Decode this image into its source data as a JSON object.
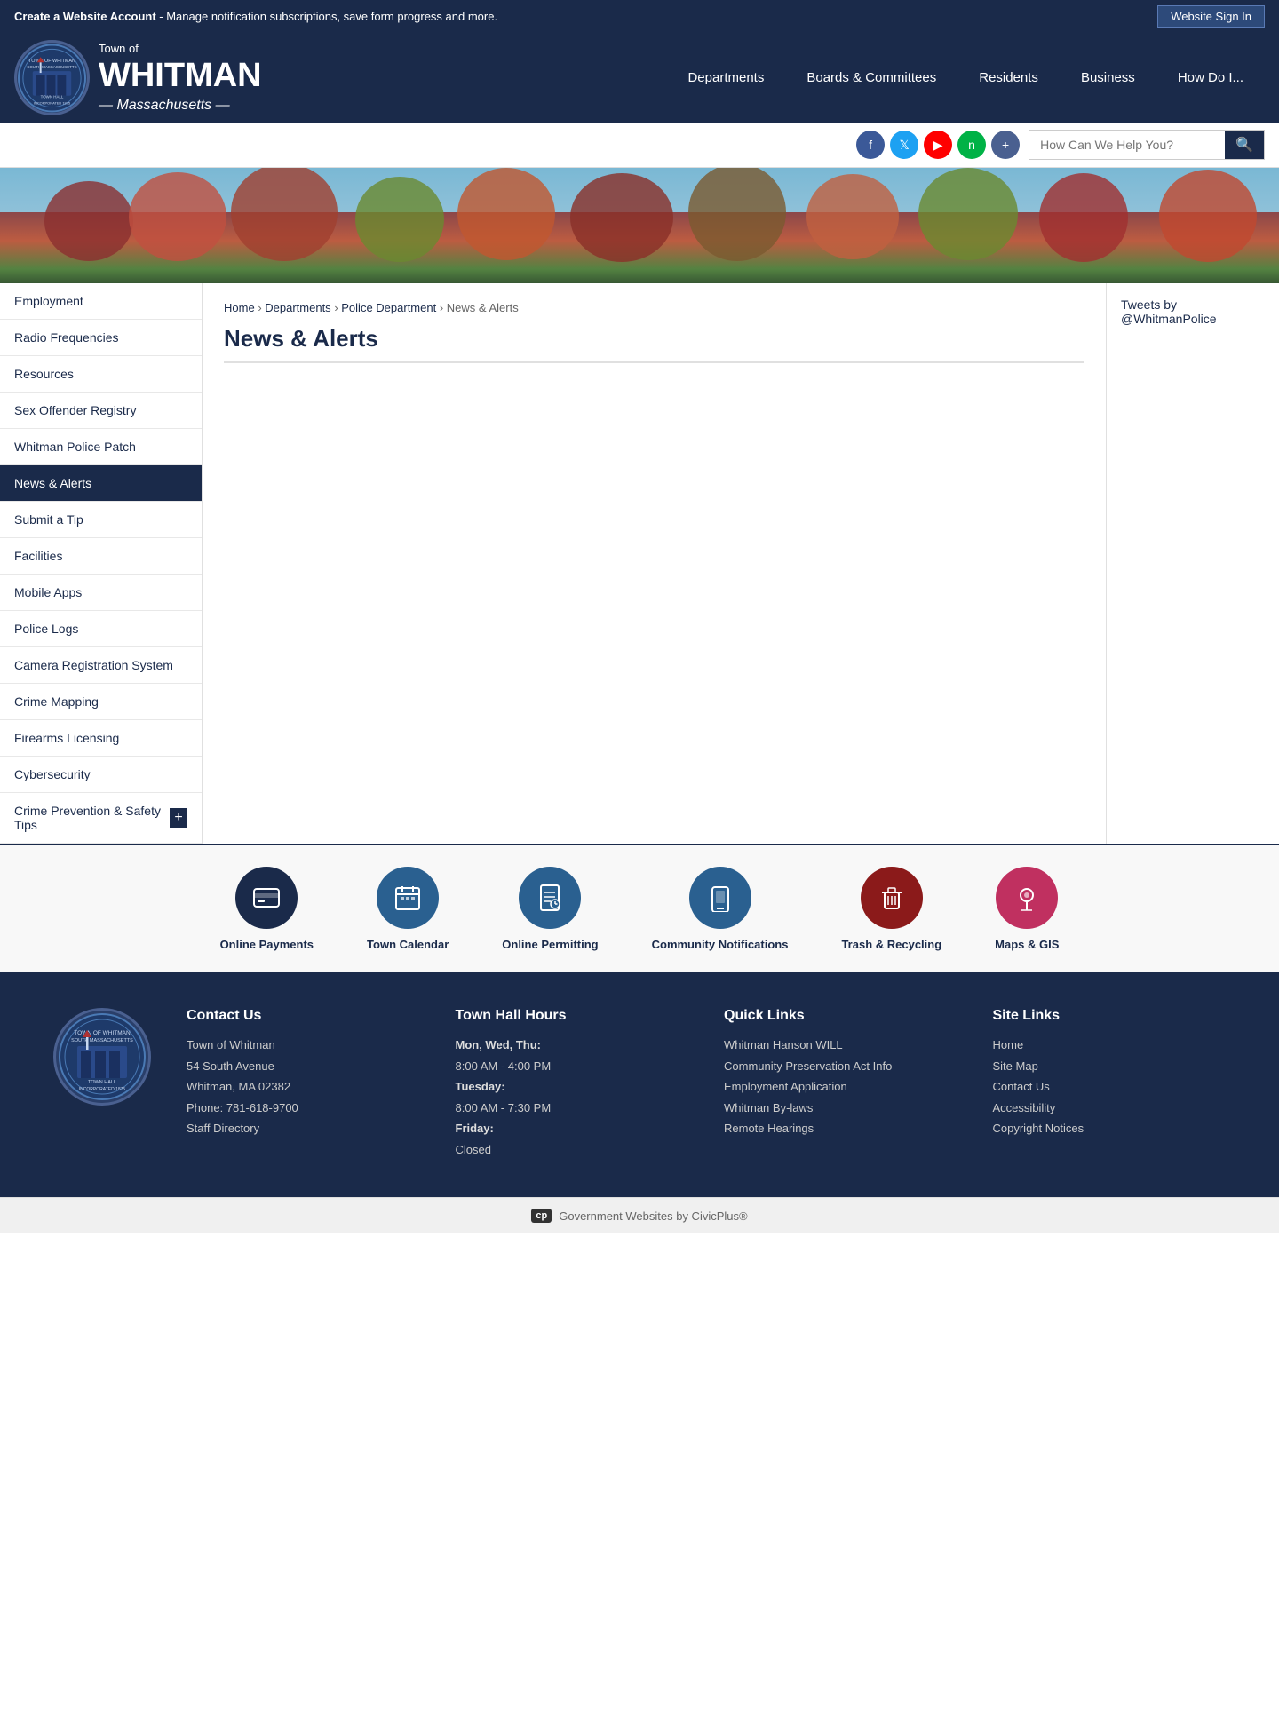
{
  "topbar": {
    "create_account_text": "Create a Website Account",
    "create_account_desc": " - Manage notification subscriptions, save form progress and more.",
    "signin_label": "Website Sign In"
  },
  "header": {
    "town_of": "Town of",
    "whitman": "WHITMAN",
    "massachusetts": "— Massachusetts —",
    "logo_text": "TOWN OF WHITMAN SOUTH MASSACHUSETTS TOWN HALL INCORPORATED 1875"
  },
  "nav": {
    "items": [
      {
        "label": "Departments"
      },
      {
        "label": "Boards & Committees"
      },
      {
        "label": "Residents"
      },
      {
        "label": "Business"
      },
      {
        "label": "How Do I..."
      }
    ]
  },
  "social": {
    "search_placeholder": "How Can We Help You?"
  },
  "sidebar": {
    "items": [
      {
        "label": "Employment"
      },
      {
        "label": "Radio Frequencies"
      },
      {
        "label": "Resources"
      },
      {
        "label": "Sex Offender Registry"
      },
      {
        "label": "Whitman Police Patch"
      },
      {
        "label": "News & Alerts"
      },
      {
        "label": "Submit a Tip"
      },
      {
        "label": "Facilities"
      },
      {
        "label": "Mobile Apps"
      },
      {
        "label": "Police Logs"
      },
      {
        "label": "Camera Registration System"
      },
      {
        "label": "Crime Mapping"
      },
      {
        "label": "Firearms Licensing"
      },
      {
        "label": "Cybersecurity"
      },
      {
        "label": "Crime Prevention & Safety Tips",
        "has_plus": true
      }
    ]
  },
  "breadcrumb": {
    "home": "Home",
    "departments": "Departments",
    "police_department": "Police Department",
    "current": "News & Alerts"
  },
  "main": {
    "page_title": "News & Alerts"
  },
  "twitter": {
    "link_text": "Tweets by @WhitmanPolice"
  },
  "quick_links": {
    "items": [
      {
        "label": "Online Payments",
        "icon": "💳",
        "color": "ql-dark-blue"
      },
      {
        "label": "Town Calendar",
        "icon": "📅",
        "color": "ql-medium-blue"
      },
      {
        "label": "Online Permitting",
        "icon": "📋",
        "color": "ql-medium-blue"
      },
      {
        "label": "Community Notifications",
        "icon": "📱",
        "color": "ql-medium-blue"
      },
      {
        "label": "Trash & Recycling",
        "icon": "🗑",
        "color": "ql-red"
      },
      {
        "label": "Maps & GIS",
        "icon": "📍",
        "color": "ql-pink"
      }
    ]
  },
  "footer": {
    "contact": {
      "title": "Contact Us",
      "org": "Town of Whitman",
      "address1": "54 South Avenue",
      "address2": "Whitman, MA 02382",
      "phone": "Phone: 781-618-9700",
      "staff_directory": "Staff Directory"
    },
    "hours": {
      "title": "Town Hall Hours",
      "mon_wed_thu_label": "Mon, Wed, Thu:",
      "mon_wed_thu_hours": "8:00 AM - 4:00 PM",
      "tue_label": "Tuesday:",
      "tue_hours": "8:00 AM - 7:30 PM",
      "fri_label": "Friday:",
      "fri_hours": "Closed"
    },
    "quick_links": {
      "title": "Quick Links",
      "items": [
        {
          "label": "Whitman Hanson WILL"
        },
        {
          "label": "Community Preservation Act Info"
        },
        {
          "label": "Employment Application"
        },
        {
          "label": "Whitman By-laws"
        },
        {
          "label": "Remote Hearings"
        }
      ]
    },
    "site_links": {
      "title": "Site Links",
      "items": [
        {
          "label": "Home"
        },
        {
          "label": "Site Map"
        },
        {
          "label": "Contact Us"
        },
        {
          "label": "Accessibility"
        },
        {
          "label": "Copyright Notices"
        }
      ]
    },
    "bottom_text": "Government Websites by CivicPlus®"
  }
}
